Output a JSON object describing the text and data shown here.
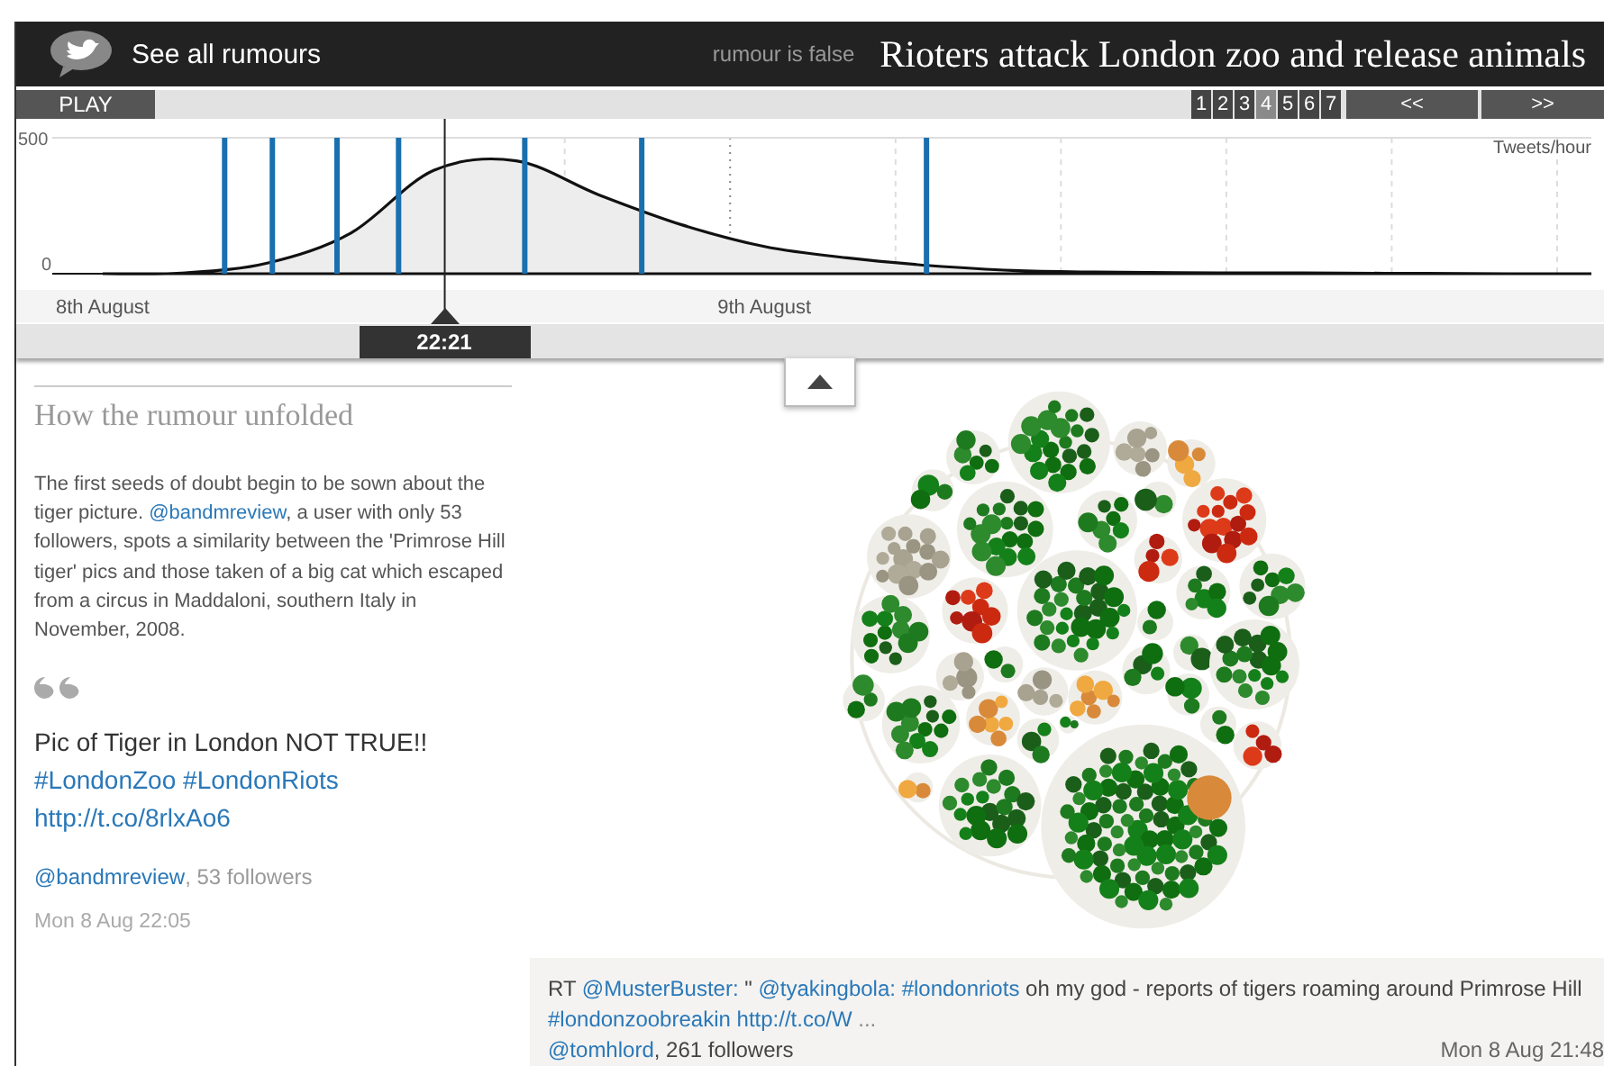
{
  "header": {
    "title": "See all rumours",
    "verdict": "rumour is false",
    "rumour": "Rioters attack London zoo and release animals"
  },
  "controls": {
    "play": "PLAY",
    "prev": "<<",
    "next": ">>",
    "pages": [
      {
        "label": "1",
        "selected": false
      },
      {
        "label": "2",
        "selected": false
      },
      {
        "label": "3",
        "selected": false
      },
      {
        "label": "4",
        "selected": true
      },
      {
        "label": "5",
        "selected": false
      },
      {
        "label": "6",
        "selected": false
      },
      {
        "label": "7",
        "selected": false
      }
    ]
  },
  "timeline": {
    "chart_data": {
      "type": "area",
      "grid": true,
      "ylabel": "Tweets/hour",
      "ylim": [
        0,
        500
      ],
      "yticks": [
        0,
        500
      ],
      "categories": [
        "8th August",
        null,
        null,
        null,
        null,
        null,
        null,
        null,
        "9th August",
        null,
        null,
        null,
        null,
        null,
        null,
        null,
        null,
        null,
        null
      ],
      "series": [
        {
          "color": "#111111",
          "values": [
            0,
            3,
            40,
            150,
            380,
            415,
            290,
            180,
            100,
            58,
            30,
            12,
            6,
            4,
            3,
            2,
            1,
            0,
            0
          ]
        }
      ]
    },
    "playhead": {
      "time": "22:21",
      "level": 0.255
    }
  },
  "story": {
    "heading": "How the rumour unfolded",
    "paragraph": [
      {
        "kind": "text",
        "text": "The first seeds of doubt begin to be sown about the tiger picture. "
      },
      {
        "kind": "link",
        "text": "@bandmreview"
      },
      {
        "kind": "text",
        "text": ", a user with only 53 followers, spots a similarity between the 'Primrose Hill tiger' pics and those taken of a big cat which escaped from a circus in Maddaloni, southern Italy in November, 2008."
      }
    ],
    "quote": [
      [
        {
          "kind": "text",
          "text": "Pic of Tiger in London NOT TRUE!!"
        }
      ],
      [
        {
          "kind": "link",
          "text": "#LondonZoo"
        },
        {
          "kind": "link",
          "text": "#LondonRiots"
        }
      ],
      [
        {
          "kind": "link",
          "text": "http://t.co/8rlxAo6"
        }
      ]
    ],
    "author": {
      "handle": "@bandmreview",
      "followers": ", 53 followers"
    },
    "time": "Mon 8 Aug 22:05"
  },
  "tweet": {
    "lines": [
      [
        {
          "kind": "text",
          "text": "RT"
        },
        {
          "kind": "link",
          "text": "@MusterBuster:"
        },
        {
          "kind": "text",
          "text": "\""
        },
        {
          "kind": "link",
          "text": "@tyakingbola:"
        },
        {
          "kind": "link",
          "text": "#londonriots"
        },
        {
          "kind": "text",
          "text": "oh my god - reports of tigers roaming around Primrose Hill"
        }
      ],
      [
        {
          "kind": "link",
          "text": "#londonzoobreakin"
        },
        {
          "kind": "link",
          "text": "http://t.co/W"
        },
        {
          "kind": "muted",
          "text": "..."
        }
      ]
    ],
    "author": {
      "handle": "@tomhlord",
      "followers": ", 261 followers"
    },
    "time": "Mon 8 Aug 21:48"
  }
}
